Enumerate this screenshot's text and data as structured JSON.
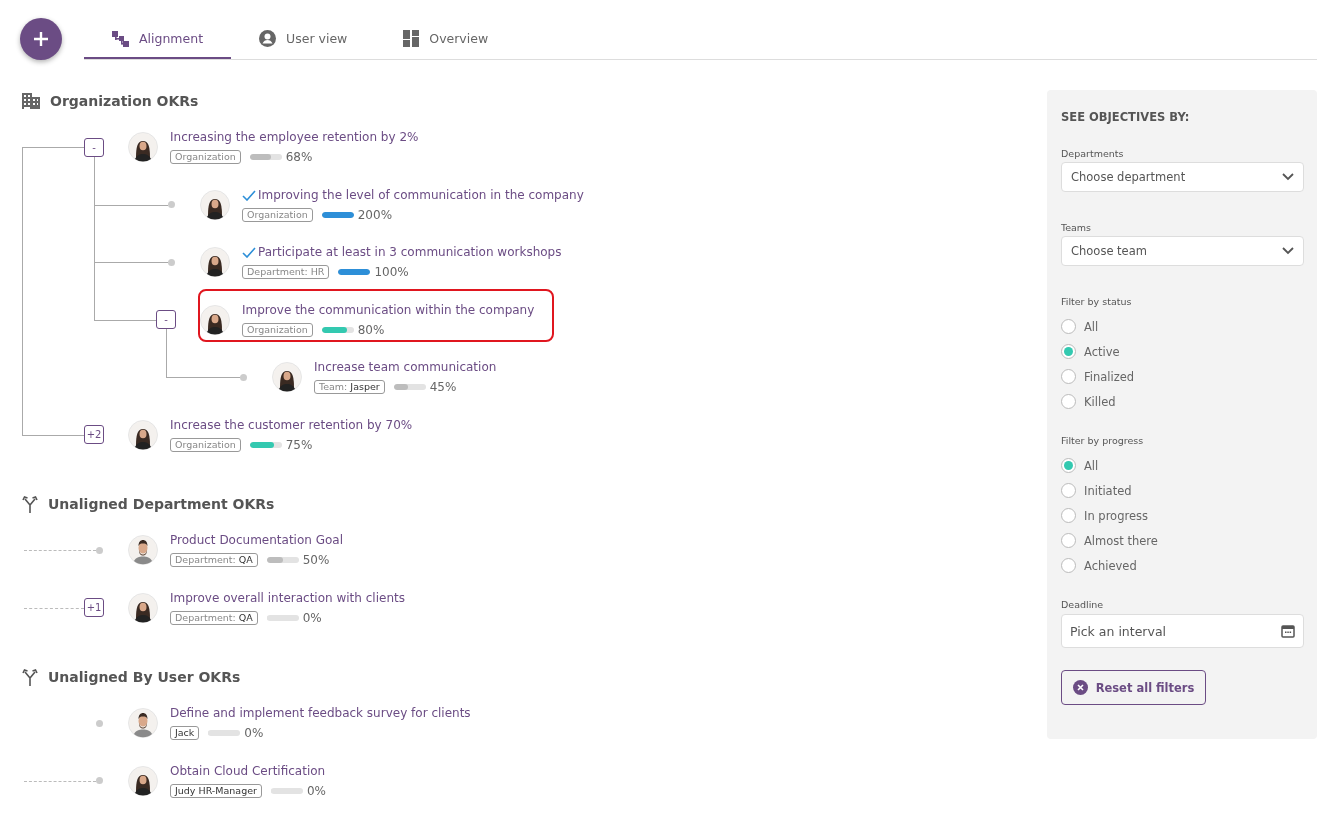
{
  "tabs": [
    {
      "label": "Alignment",
      "selected": true
    },
    {
      "label": "User view",
      "selected": false
    },
    {
      "label": "Overview",
      "selected": false
    }
  ],
  "sections": [
    {
      "title": "Organization OKRs",
      "kind": "tree",
      "items": [
        {
          "title": "Increasing the employee retention by 2%",
          "kind": "woman",
          "tag": {
            "label": "Organization"
          },
          "level": 0.68,
          "color": "#bdbdbd",
          "reading": "68%",
          "achieved": false,
          "highlighted": false,
          "toggle": "-",
          "children": [
            {
              "title": "Improving the level of communication in the company",
              "kind": "woman",
              "tag": {
                "label": "Organization"
              },
              "level": 1,
              "color": "#2d8fd8",
              "reading": "200%",
              "achieved": true,
              "highlighted": false
            },
            {
              "title": "Participate at least in 3 communication workshops",
              "kind": "woman",
              "tag": {
                "label": "Department: HR"
              },
              "level": 1,
              "color": "#2d8fd8",
              "reading": "100%",
              "achieved": true,
              "highlighted": false
            },
            {
              "title": "Improve the communication within the company",
              "kind": "woman",
              "tag": {
                "label": "Organization"
              },
              "level": 0.8,
              "color": "#33c9b0",
              "reading": "80%",
              "achieved": false,
              "highlighted": true,
              "toggle": "-",
              "children": [
                {
                  "title": "Increase team communication",
                  "kind": "woman",
                  "tag": {
                    "label": "Team:",
                    "value": "Jasper"
                  },
                  "level": 0.45,
                  "color": "#bdbdbd",
                  "reading": "45%",
                  "achieved": false,
                  "highlighted": false
                }
              ]
            }
          ]
        },
        {
          "title": "Increase the customer retention by 70%",
          "kind": "woman",
          "tag": {
            "label": "Organization"
          },
          "level": 0.75,
          "color": "#33c9b0",
          "reading": "75%",
          "achieved": false,
          "highlighted": false,
          "toggle": "+2"
        }
      ]
    },
    {
      "title": "Unaligned Department OKRs",
      "kind": "flat",
      "items": [
        {
          "title": "Product Documentation Goal",
          "kind": "man",
          "tag": {
            "label": "Department:",
            "value": "QA"
          },
          "level": 0.5,
          "color": "#bdbdbd",
          "reading": "50%",
          "achieved": false,
          "highlighted": false,
          "linked": true
        },
        {
          "title": "Improve overall interaction with clients",
          "kind": "woman",
          "tag": {
            "label": "Department:",
            "value": "QA"
          },
          "level": 0,
          "reading": "0%",
          "achieved": false,
          "highlighted": false,
          "linked": true,
          "toggle": "+1"
        }
      ]
    },
    {
      "title": "Unaligned By User OKRs",
      "kind": "flat",
      "items": [
        {
          "title": "Define and implement feedback survey for clients",
          "kind": "man",
          "tag": {
            "value": "Jack"
          },
          "level": 0,
          "reading": "0%",
          "achieved": false,
          "highlighted": false,
          "linked": false
        },
        {
          "title": "Obtain Cloud Certification",
          "kind": "woman",
          "tag": {
            "value": "Judy HR-Manager"
          },
          "level": 0,
          "reading": "0%",
          "achieved": false,
          "highlighted": false,
          "linked": true
        }
      ]
    }
  ],
  "filters": {
    "title": "SEE OBJECTIVES BY:",
    "departments": {
      "label": "Departments",
      "placeholder": "Choose department"
    },
    "teams": {
      "label": "Teams",
      "placeholder": "Choose team"
    },
    "status": {
      "label": "Filter by status",
      "options": [
        {
          "label": "All",
          "selected": false
        },
        {
          "label": "Active",
          "selected": true
        },
        {
          "label": "Finalized",
          "selected": false
        },
        {
          "label": "Killed",
          "selected": false
        }
      ]
    },
    "progress": {
      "label": "Filter by progress",
      "options": [
        {
          "label": "All",
          "selected": true
        },
        {
          "label": "Initiated",
          "selected": false
        },
        {
          "label": "In progress",
          "selected": false
        },
        {
          "label": "Almost there",
          "selected": false
        },
        {
          "label": "Achieved",
          "selected": false
        }
      ]
    },
    "deadline": {
      "label": "Deadline",
      "placeholder": "Pick an interval"
    },
    "reset": "Reset all filters"
  }
}
